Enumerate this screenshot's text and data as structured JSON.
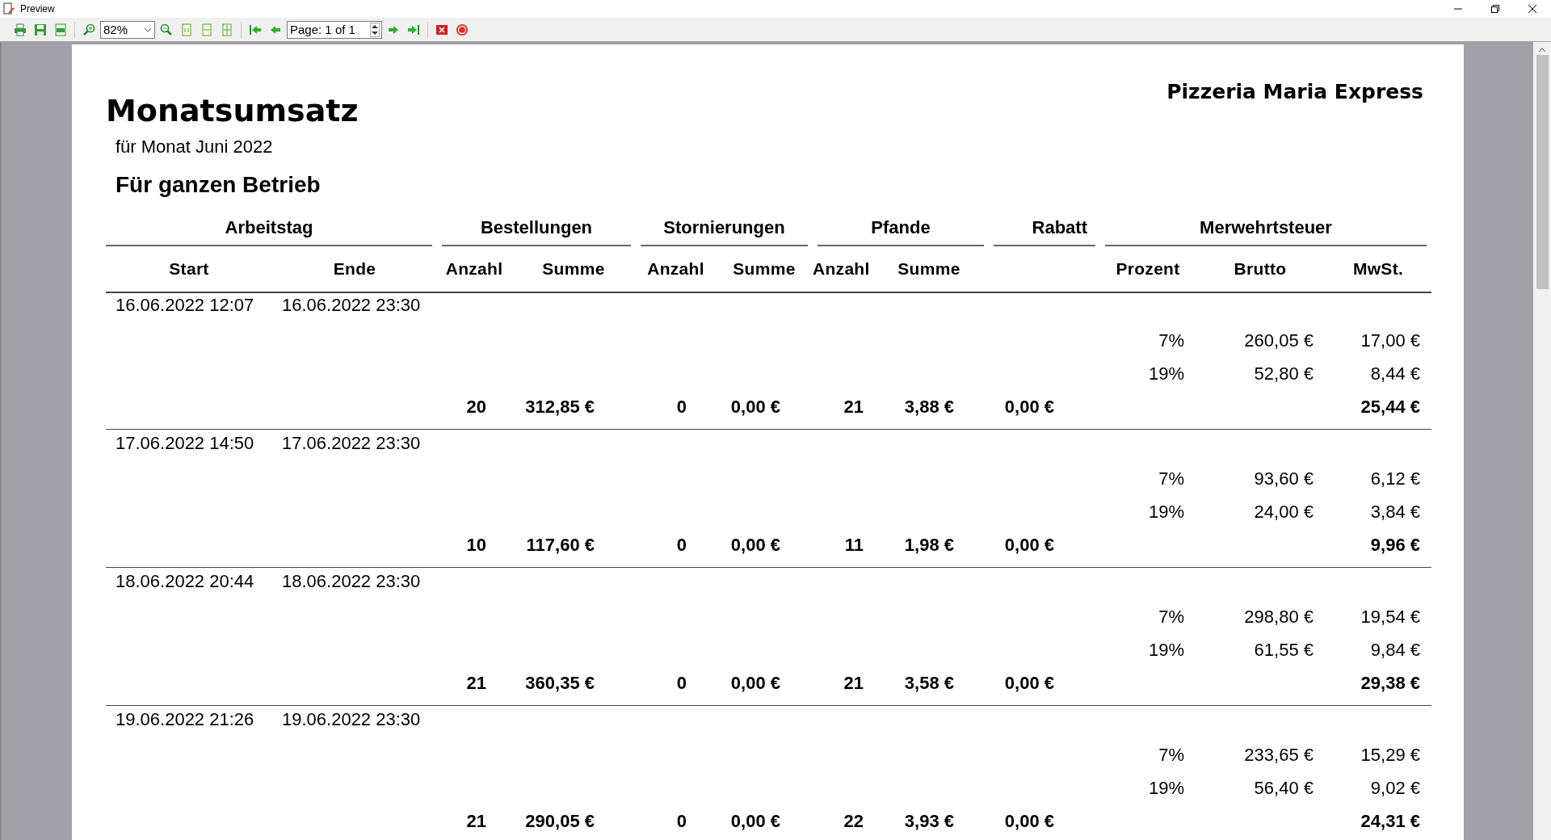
{
  "window": {
    "title": "Preview"
  },
  "toolbar": {
    "zoom": "82%",
    "page": "Page: 1 of 1"
  },
  "report": {
    "title": "Monatsumsatz",
    "company": "Pizzeria Maria Express",
    "subtitle": "für Monat Juni 2022",
    "scope": "Für ganzen Betrieb",
    "groups": [
      "Arbeitstag",
      "Bestellungen",
      "Stornierungen",
      "Pfande",
      "Rabatt",
      "Merwehrtsteuer"
    ],
    "columns": [
      "Start",
      "Ende",
      "Anzahl",
      "Summe",
      "Anzahl",
      "Summe",
      "Anzahl",
      "Summe",
      "",
      "Prozent",
      "Brutto",
      "MwSt."
    ],
    "days": [
      {
        "start": "16.06.2022 12:07",
        "end": "16.06.2022 23:30",
        "vat": [
          {
            "rate": "7%",
            "gross": "260,05 €",
            "tax": "17,00 €"
          },
          {
            "rate": "19%",
            "gross": "52,80 €",
            "tax": "8,44 €"
          }
        ],
        "totals": [
          "20",
          "312,85 €",
          "0",
          "0,00 €",
          "21",
          "3,88 €",
          "0,00 €",
          "25,44 €"
        ]
      },
      {
        "start": "17.06.2022 14:50",
        "end": "17.06.2022 23:30",
        "vat": [
          {
            "rate": "7%",
            "gross": "93,60 €",
            "tax": "6,12 €"
          },
          {
            "rate": "19%",
            "gross": "24,00 €",
            "tax": "3,84 €"
          }
        ],
        "totals": [
          "10",
          "117,60 €",
          "0",
          "0,00 €",
          "11",
          "1,98 €",
          "0,00 €",
          "9,96 €"
        ]
      },
      {
        "start": "18.06.2022 20:44",
        "end": "18.06.2022 23:30",
        "vat": [
          {
            "rate": "7%",
            "gross": "298,80 €",
            "tax": "19,54 €"
          },
          {
            "rate": "19%",
            "gross": "61,55 €",
            "tax": "9,84 €"
          }
        ],
        "totals": [
          "21",
          "360,35 €",
          "0",
          "0,00 €",
          "21",
          "3,58 €",
          "0,00 €",
          "29,38 €"
        ]
      },
      {
        "start": "19.06.2022 21:26",
        "end": "19.06.2022 23:30",
        "vat": [
          {
            "rate": "7%",
            "gross": "233,65 €",
            "tax": "15,29 €"
          },
          {
            "rate": "19%",
            "gross": "56,40 €",
            "tax": "9,02 €"
          }
        ],
        "totals": [
          "21",
          "290,05 €",
          "0",
          "0,00 €",
          "22",
          "3,93 €",
          "0,00 €",
          "24,31 €"
        ]
      }
    ]
  }
}
